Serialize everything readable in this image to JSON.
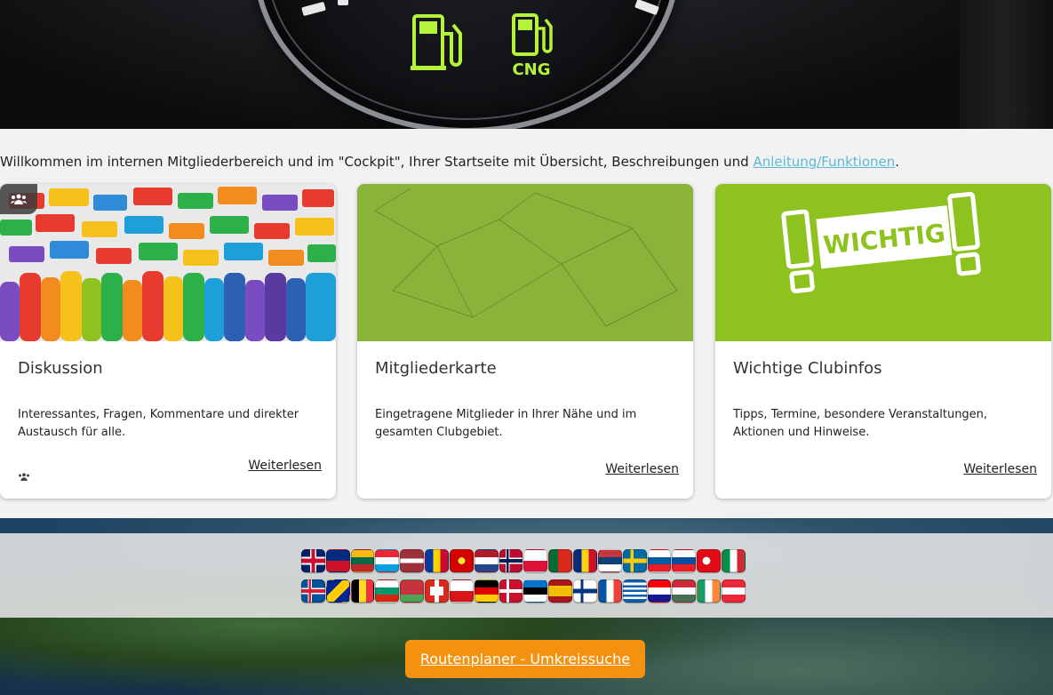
{
  "welcome": {
    "text": "Willkommen im internen Mitgliederbereich und im \"Cockpit\", Ihrer Startseite mit Übersicht, Beschreibungen und ",
    "link": "Anleitung/Funktionen",
    "suffix": "."
  },
  "hero": {
    "cng_label": "CNG"
  },
  "cards": [
    {
      "title": "Diskussion",
      "description": "Interessantes, Fragen, Kommentare und direkter Austausch für alle.",
      "more": "Weiterlesen"
    },
    {
      "title": "Mitgliederkarte",
      "description": "Eingetragene Mitglieder in Ihrer Nähe und im gesamten Clubgebiet.",
      "more": "Weiterlesen"
    },
    {
      "title": "Wichtige Clubinfos",
      "description": "Tipps, Termine, besondere Veranstaltungen, Aktionen und Hinweise.",
      "more": "Weiterlesen",
      "image_text": "WICHTIG"
    }
  ],
  "flags_row1": [
    "gb",
    "li",
    "lt",
    "lu",
    "lv",
    "md",
    "mk",
    "nl",
    "no",
    "pl",
    "pt",
    "ro",
    "rs",
    "se",
    "si",
    "sk",
    "tr",
    "it"
  ],
  "flags_row2": [
    "is",
    "ba",
    "be",
    "bg",
    "by",
    "ch",
    "cz",
    "de",
    "dk",
    "ee",
    "es",
    "fi",
    "fr",
    "gr",
    "hr",
    "hu",
    "ie",
    "at"
  ],
  "route_button": "Routenplaner - Umkreissuche",
  "colors": {
    "accent_orange": "#f4920f",
    "link_blue": "#5fb8d8",
    "green_brand": "#8dc21f"
  }
}
